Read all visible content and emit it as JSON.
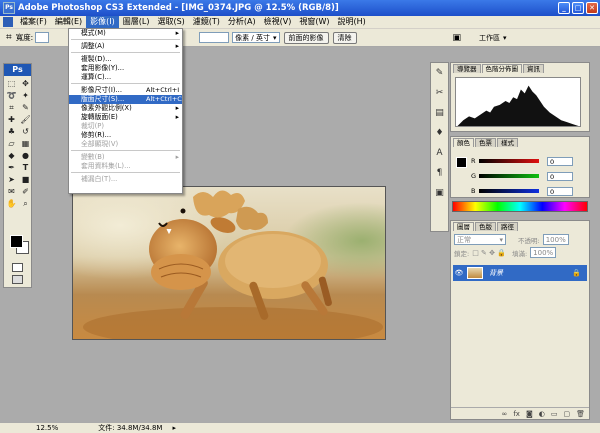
{
  "window": {
    "title": "Adobe Photoshop CS3 Extended - [IMG_0374.JPG @ 12.5% (RGB/8)]",
    "minimize_icon": "minimize-icon",
    "maximize_icon": "maximize-icon",
    "close_icon": "close-icon"
  },
  "menubar": {
    "items": [
      "檔案(F)",
      "編輯(E)",
      "影像(I)",
      "圖層(L)",
      "選取(S)",
      "濾鏡(T)",
      "分析(A)",
      "檢視(V)",
      "視窗(W)",
      "說明(H)"
    ],
    "active": "影像(I)"
  },
  "options": {
    "width_label": "寬度:",
    "units_value": "像素 / 英寸",
    "front_image_label": "前面的影像",
    "clear_label": "清除",
    "workspace_label": "工作區"
  },
  "image_menu": {
    "items": [
      {
        "label": "模式(M)",
        "submenu": true,
        "state": "normal"
      },
      {
        "sep": true
      },
      {
        "label": "調整(A)",
        "submenu": true,
        "state": "normal"
      },
      {
        "sep": true
      },
      {
        "label": "複製(D)...",
        "state": "normal"
      },
      {
        "label": "套用影像(Y)...",
        "state": "normal"
      },
      {
        "label": "運算(C)...",
        "state": "normal"
      },
      {
        "sep": true
      },
      {
        "label": "影像尺寸(I)...",
        "shortcut": "Alt+Ctrl+I",
        "state": "normal"
      },
      {
        "label": "版面尺寸(S)...",
        "shortcut": "Alt+Ctrl+C",
        "state": "selected"
      },
      {
        "label": "像素外觀比例(X)",
        "submenu": true,
        "state": "normal"
      },
      {
        "label": "旋轉版面(E)",
        "submenu": true,
        "state": "normal"
      },
      {
        "label": "裁切(P)",
        "state": "disabled"
      },
      {
        "label": "修剪(R)...",
        "state": "normal"
      },
      {
        "label": "全部顯現(V)",
        "state": "disabled"
      },
      {
        "sep": true
      },
      {
        "label": "變數(B)",
        "submenu": true,
        "state": "disabled"
      },
      {
        "label": "套用資料集(L)...",
        "state": "disabled"
      },
      {
        "sep": true
      },
      {
        "label": "補漏白(T)...",
        "state": "disabled"
      }
    ]
  },
  "navigator_panel": {
    "tabs": [
      "導覽器",
      "色階分佈圖",
      "資訊"
    ],
    "active": "色階分佈圖"
  },
  "color_panel": {
    "tabs": [
      "顏色",
      "色票",
      "樣式"
    ],
    "active": "顏色",
    "rows": [
      {
        "label": "R",
        "value": "0",
        "color": "#c01818"
      },
      {
        "label": "G",
        "value": "0",
        "color": "#18a018"
      },
      {
        "label": "B",
        "value": "0",
        "color": "#1830c0"
      }
    ]
  },
  "layers_panel": {
    "tabs": [
      "圖層",
      "色版",
      "路徑"
    ],
    "active": "圖層",
    "blend_mode": "正常",
    "opacity_label": "不透明:",
    "opacity_value": "100%",
    "lock_label": "鎖定:",
    "fill_label": "填滿:",
    "fill_value": "100%",
    "layer_name": "背景"
  },
  "status": {
    "zoom": "12.5%",
    "doc_info": "文件: 34.8M/34.8M"
  }
}
